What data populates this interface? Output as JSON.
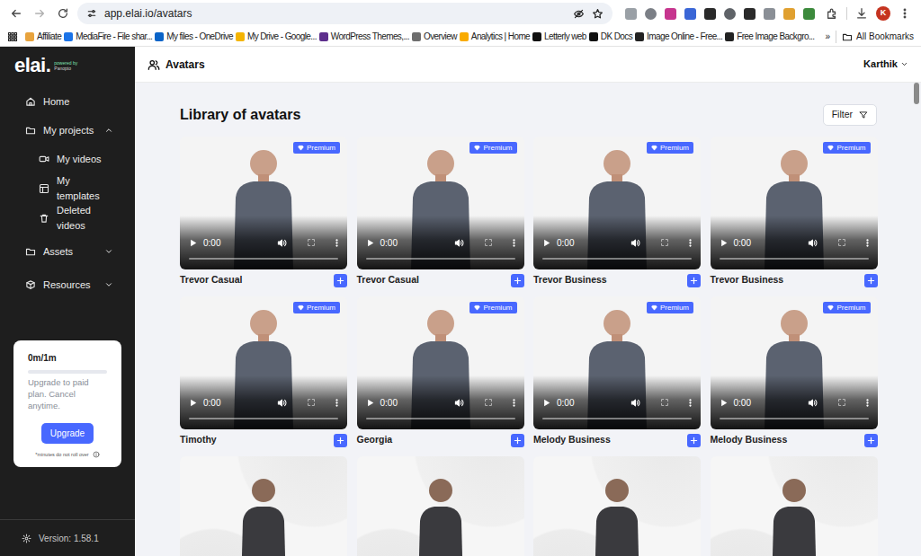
{
  "browser": {
    "url": "app.elai.io/avatars",
    "profile": "K",
    "bookmarks": [
      "Affiliate",
      "MediaFire - File shar...",
      "My files - OneDrive",
      "My Drive - Google...",
      "WordPress Themes,...",
      "Overview",
      "Analytics | Home",
      "Letterly web",
      "DK Docs",
      "Image Online - Free...",
      "Free Image Backgro..."
    ],
    "more": "»",
    "all_bookmarks": "All Bookmarks"
  },
  "sidebar": {
    "logo": "elai.",
    "powered_by": "powered by",
    "brand": "Panopto",
    "items": [
      {
        "label": "Home",
        "kind": "link"
      },
      {
        "label": "My projects",
        "kind": "group",
        "expanded": true
      },
      {
        "label": "My videos",
        "kind": "sub"
      },
      {
        "label": "My templates",
        "kind": "sub"
      },
      {
        "label": "Deleted videos",
        "kind": "sub"
      },
      {
        "label": "Assets",
        "kind": "group",
        "expanded": false
      },
      {
        "label": "Resources",
        "kind": "group",
        "expanded": false
      }
    ],
    "usage": {
      "reading": "0m/1m",
      "level": 0,
      "text": "Upgrade to paid plan. Cancel anytime.",
      "button": "Upgrade",
      "note": "*minutes do not roll over"
    },
    "version": "Version: 1.58.1"
  },
  "header": {
    "title": "Avatars",
    "user": "Karthik"
  },
  "library": {
    "title": "Library of avatars",
    "filter": "Filter",
    "premium_label": "Premium",
    "avatars": [
      {
        "name": "Trevor Casual",
        "premium": true,
        "time": "0:00",
        "level": 0
      },
      {
        "name": "Trevor Casual",
        "premium": true,
        "time": "0:00",
        "level": 0
      },
      {
        "name": "Trevor Business",
        "premium": true,
        "time": "0:00",
        "level": 0
      },
      {
        "name": "Trevor Business",
        "premium": true,
        "time": "0:00",
        "level": 0
      },
      {
        "name": "Timothy",
        "premium": true,
        "time": "0:00",
        "level": 0
      },
      {
        "name": "Georgia",
        "premium": true,
        "time": "0:00",
        "level": 0
      },
      {
        "name": "Melody Business",
        "premium": true,
        "time": "0:00",
        "level": 0
      },
      {
        "name": "Melody Business",
        "premium": true,
        "time": "0:00",
        "level": 0
      },
      {
        "premium": false
      },
      {
        "premium": false
      },
      {
        "premium": false
      },
      {
        "premium": false
      }
    ]
  }
}
